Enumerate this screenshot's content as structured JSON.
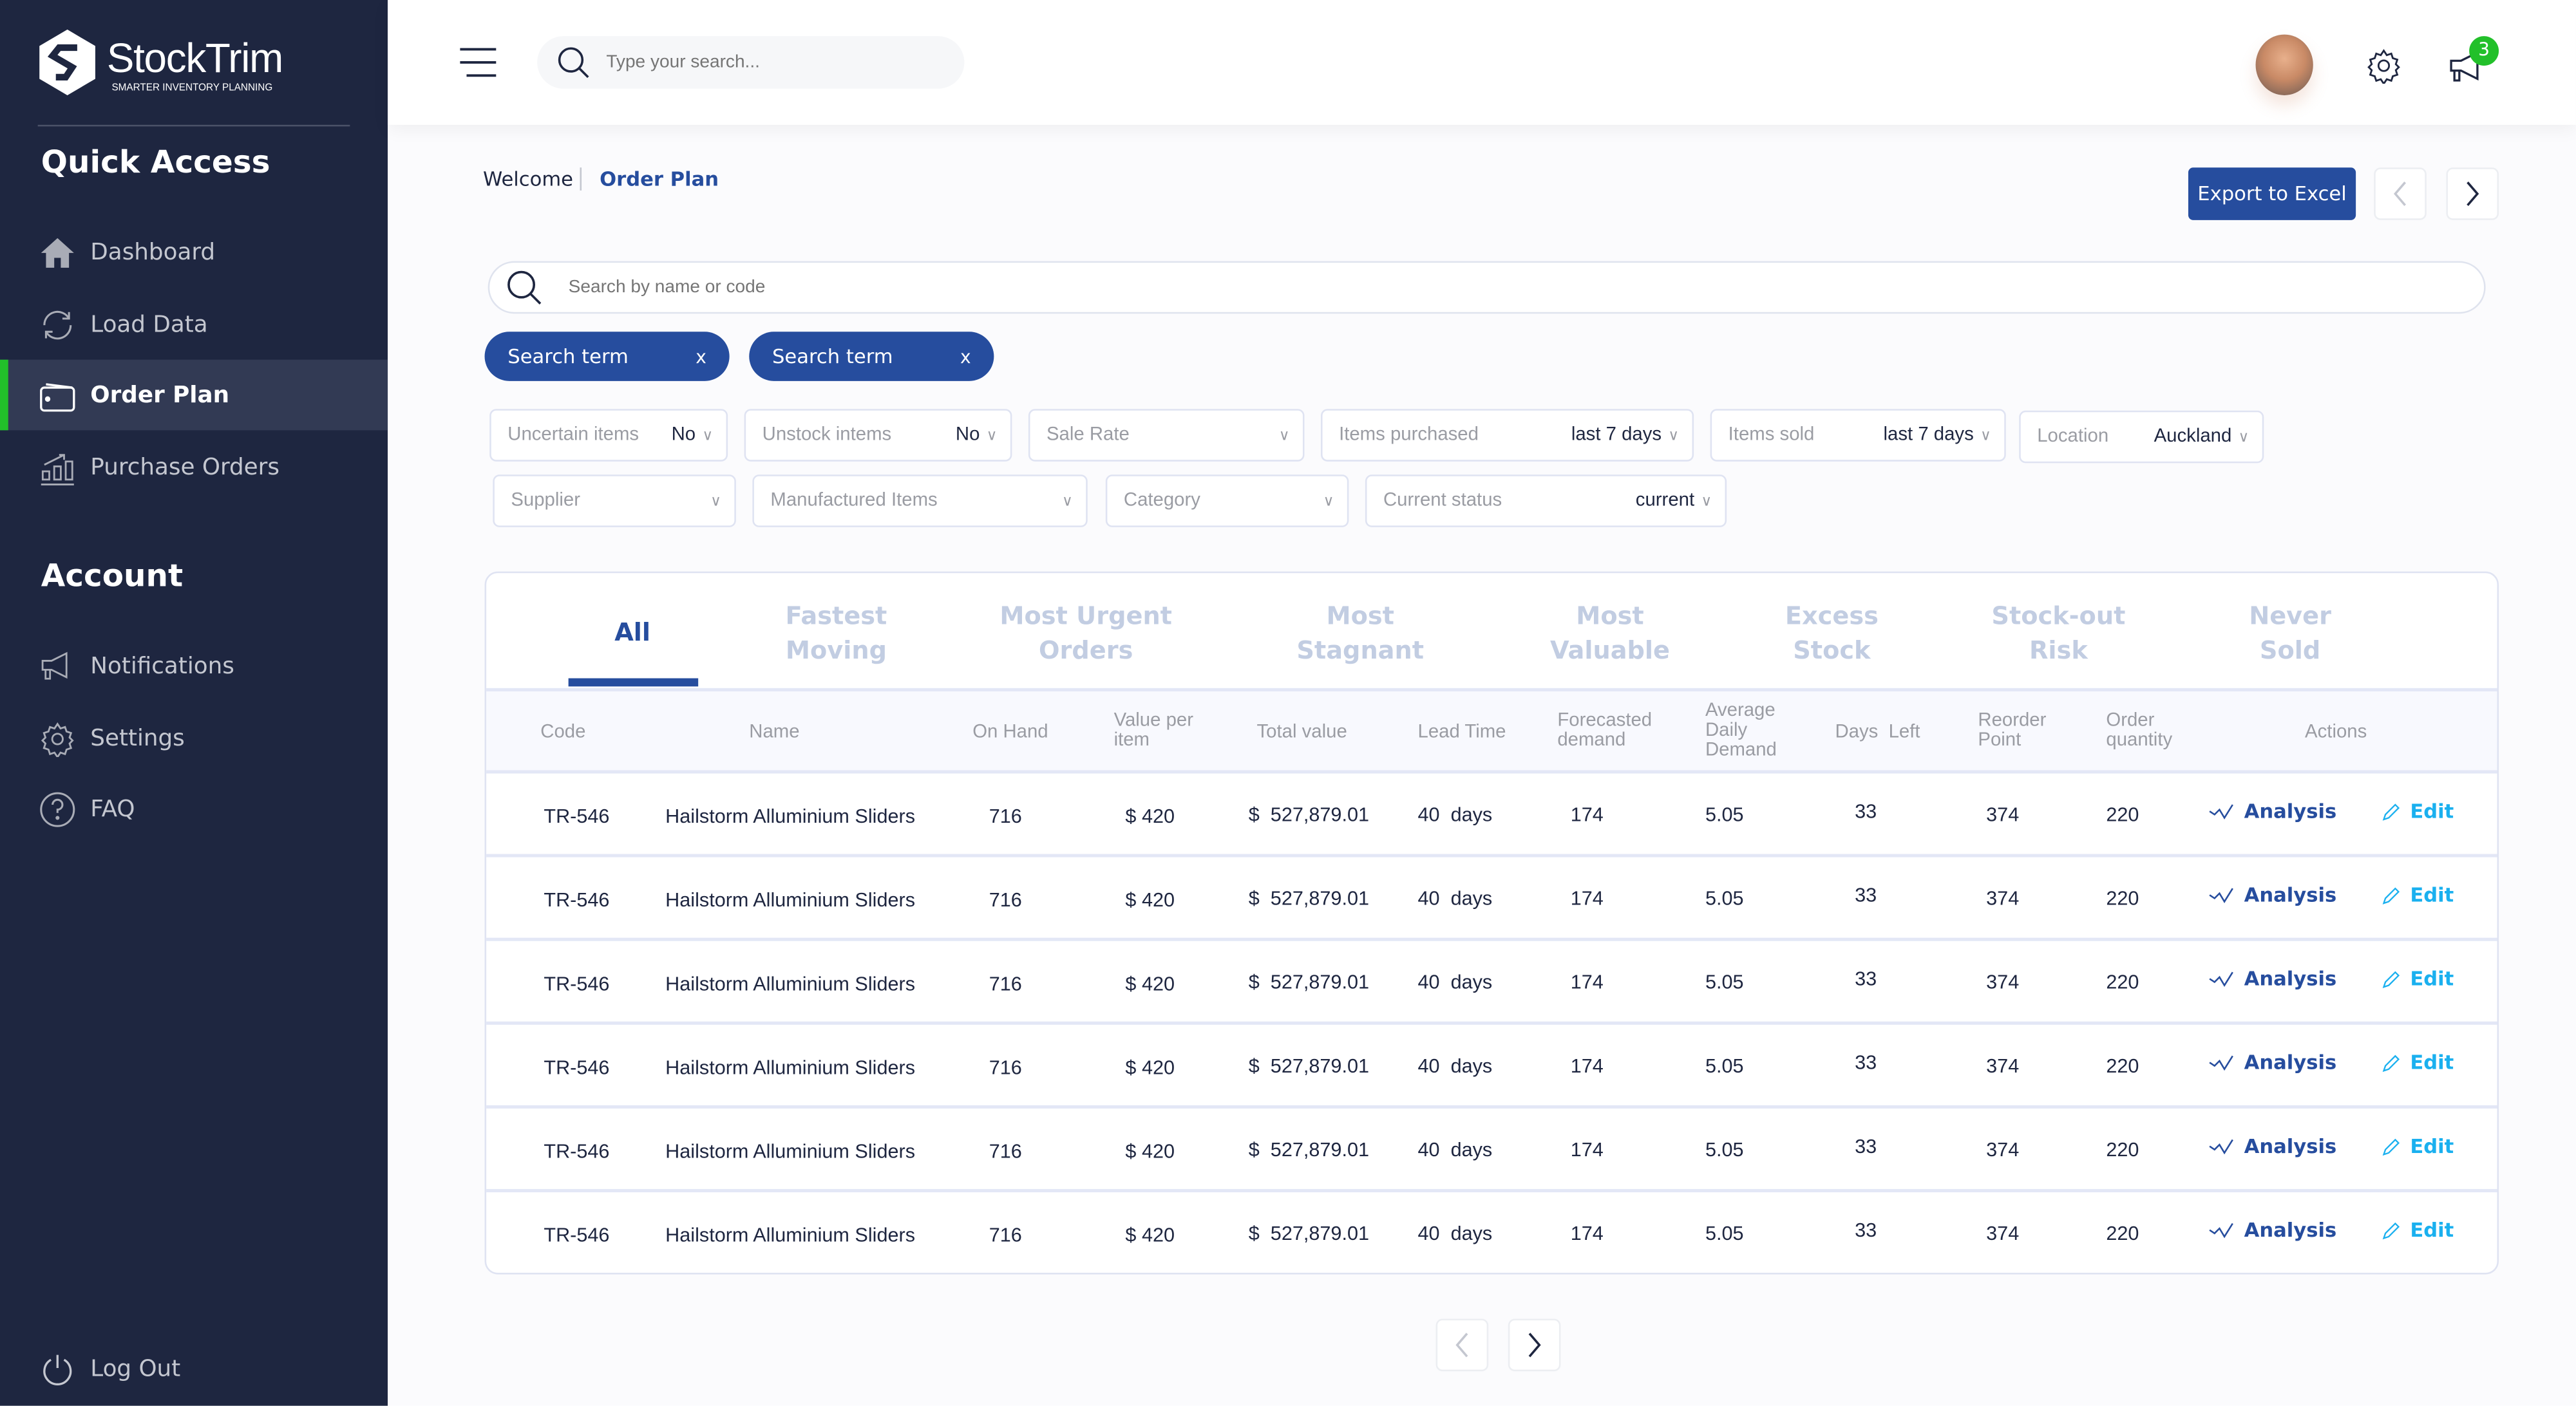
{
  "brand": {
    "name": "StockTrim",
    "tagline": "SMARTER INVENTORY PLANNING"
  },
  "sidebar": {
    "quick_access_title": "Quick Access",
    "quick_items": [
      {
        "label": "Dashboard",
        "icon": "home-icon"
      },
      {
        "label": "Load Data",
        "icon": "refresh-icon"
      },
      {
        "label": "Order Plan",
        "icon": "wallet-icon",
        "active": true
      },
      {
        "label": "Purchase Orders",
        "icon": "bar-chart-icon"
      }
    ],
    "account_title": "Account",
    "account_items": [
      {
        "label": "Notifications",
        "icon": "megaphone-icon"
      },
      {
        "label": "Settings",
        "icon": "gear-icon"
      },
      {
        "label": "FAQ",
        "icon": "question-icon"
      }
    ],
    "logout_label": "Log Out"
  },
  "header": {
    "search_placeholder": "Type your search...",
    "notification_count": "3"
  },
  "breadcrumb": {
    "root": "Welcome",
    "current": "Order Plan"
  },
  "toolbar": {
    "export_label": "Export to Excel"
  },
  "search": {
    "placeholder": "Search by name or code"
  },
  "chips": [
    {
      "label": "Search term",
      "close": "x"
    },
    {
      "label": "Search term",
      "close": "x"
    }
  ],
  "filters": [
    {
      "label": "Uncertain items",
      "value": "No"
    },
    {
      "label": "Unstock intems",
      "value": "No"
    },
    {
      "label": "Sale Rate",
      "value": ""
    },
    {
      "label": "Items purchased",
      "value": "last 7 days"
    },
    {
      "label": "Items sold",
      "value": "last 7 days"
    },
    {
      "label": "Location",
      "value": "Auckland"
    },
    {
      "label": "Supplier",
      "value": ""
    },
    {
      "label": "Manufactured Items",
      "value": ""
    },
    {
      "label": "Category",
      "value": ""
    },
    {
      "label": "Current status",
      "value": "current"
    }
  ],
  "tabs": [
    {
      "label": "All",
      "active": true
    },
    {
      "label": "Fastest Moving"
    },
    {
      "label": "Most Urgent Orders"
    },
    {
      "label": "Most Stagnant"
    },
    {
      "label": "Most Valuable"
    },
    {
      "label": "Excess Stock"
    },
    {
      "label": "Stock-out Risk"
    },
    {
      "label": "Never Sold"
    }
  ],
  "table": {
    "columns": [
      "Code",
      "Name",
      "On Hand",
      "Value per item",
      "Total value",
      "Lead Time",
      "Forecasted demand",
      "Average Daily Demand",
      "Days  Left",
      "Reorder Point",
      "Order quantity",
      "Actions"
    ],
    "action_labels": {
      "analysis": "Analysis",
      "edit": "Edit"
    },
    "rows": [
      [
        "TR-546",
        "Hailstorm Alluminium Sliders",
        "716",
        "$ 420",
        "$  527,879.01",
        "40  days",
        "174",
        "5.05",
        "33",
        "374",
        "220"
      ],
      [
        "TR-546",
        "Hailstorm Alluminium Sliders",
        "716",
        "$ 420",
        "$  527,879.01",
        "40  days",
        "174",
        "5.05",
        "33",
        "374",
        "220"
      ],
      [
        "TR-546",
        "Hailstorm Alluminium Sliders",
        "716",
        "$ 420",
        "$  527,879.01",
        "40  days",
        "174",
        "5.05",
        "33",
        "374",
        "220"
      ],
      [
        "TR-546",
        "Hailstorm Alluminium Sliders",
        "716",
        "$ 420",
        "$  527,879.01",
        "40  days",
        "174",
        "5.05",
        "33",
        "374",
        "220"
      ],
      [
        "TR-546",
        "Hailstorm Alluminium Sliders",
        "716",
        "$ 420",
        "$  527,879.01",
        "40  days",
        "174",
        "5.05",
        "33",
        "374",
        "220"
      ],
      [
        "TR-546",
        "Hailstorm Alluminium Sliders",
        "716",
        "$ 420",
        "$  527,879.01",
        "40  days",
        "174",
        "5.05",
        "33",
        "374",
        "220"
      ]
    ]
  },
  "colors": {
    "sidebar": "#1e2640",
    "primary": "#264d9e",
    "active_indicator": "#22c02a",
    "edit": "#1ab0ef",
    "tab_inactive": "#c2cde2"
  }
}
